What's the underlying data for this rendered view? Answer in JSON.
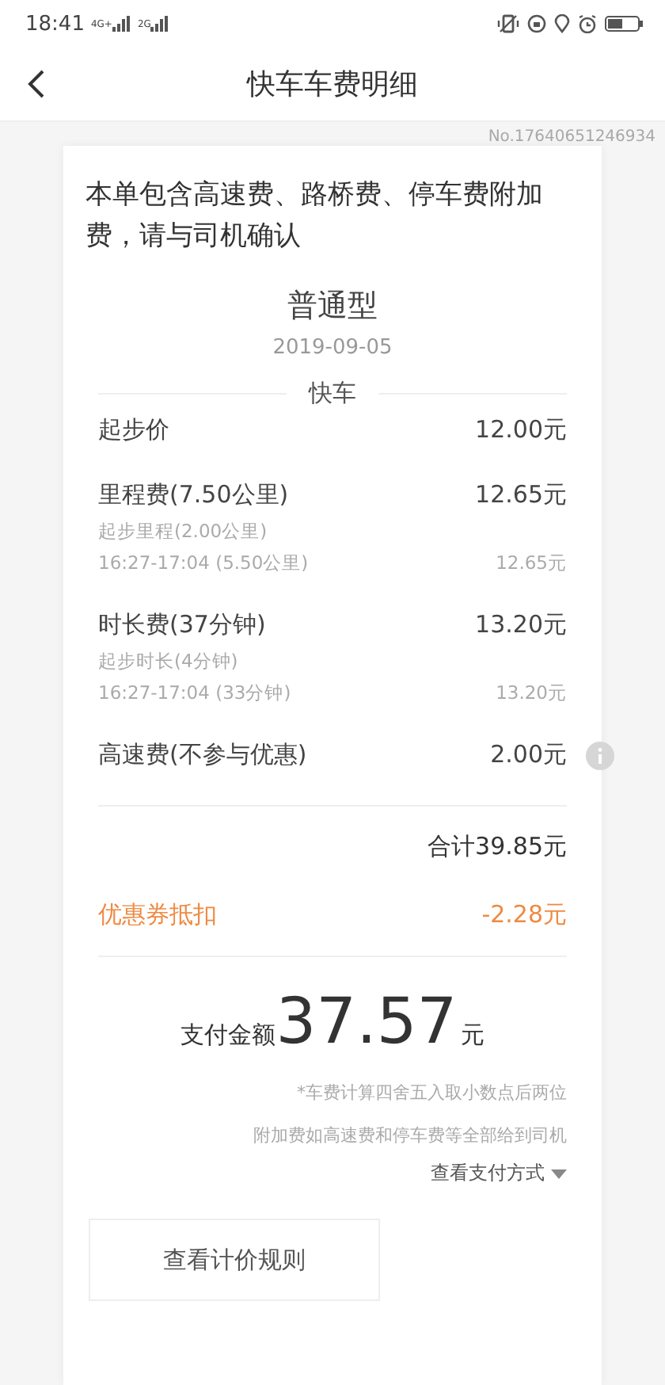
{
  "status_bar": {
    "time": "18:41",
    "network_1": "4G+",
    "network_2": "2G"
  },
  "header": {
    "title": "快车车费明细"
  },
  "order_no": "No.17640651246934",
  "notice": "本单包含高速费、路桥费、停车费附加费，请与司机确认",
  "car_type": "普通型",
  "date": "2019-09-05",
  "section_title": "快车",
  "fees": [
    {
      "label": "起步价",
      "amount": "12.00元",
      "info": false
    },
    {
      "label": "里程费(7.50公里)",
      "amount": "12.65元",
      "info": false,
      "details": [
        {
          "label": "起步里程(2.00公里)"
        },
        {
          "label": "16:27-17:04 (5.50公里)",
          "amount": "12.65元"
        }
      ]
    },
    {
      "label": "时长费(37分钟)",
      "amount": "13.20元",
      "info": false,
      "details": [
        {
          "label": "起步时长(4分钟)"
        },
        {
          "label": "16:27-17:04 (33分钟)",
          "amount": "13.20元"
        }
      ]
    },
    {
      "label": "高速费(不参与优惠)",
      "amount": "2.00元",
      "info": true
    }
  ],
  "total": "合计39.85元",
  "discount": {
    "label": "优惠券抵扣",
    "amount": "-2.28元"
  },
  "payment": {
    "label": "支付金额",
    "amount": "37.57",
    "unit": "元"
  },
  "notes": [
    "*车费计算四舍五入取小数点后两位",
    "附加费如高速费和停车费等全部给到司机"
  ],
  "pay_method_link": "查看支付方式",
  "rules_button": "查看计价规则"
}
